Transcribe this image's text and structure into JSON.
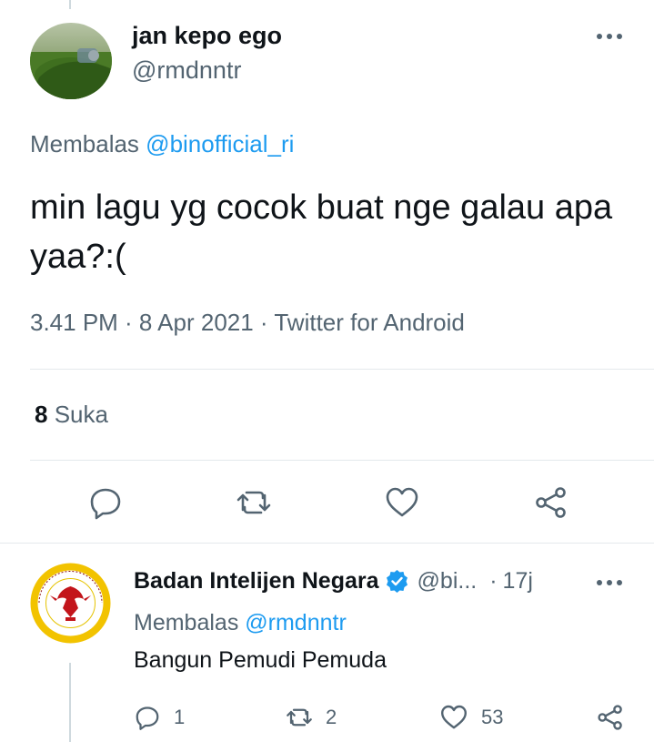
{
  "tweet": {
    "author_name": "jan kepo ego",
    "author_handle": "@rmdnntr",
    "reply_prefix": "Membalas",
    "reply_to": "@binofficial_ri",
    "text": "min lagu yg cocok buat nge galau apa yaa?:(",
    "meta": "3.41 PM · 8 Apr 2021 · Twitter for Android",
    "likes_count": "8",
    "likes_label": "Suka"
  },
  "reply": {
    "author_name": "Badan Intelijen Negara",
    "author_handle": "@bi...",
    "time_sep": "·",
    "time": "17j",
    "reply_prefix": "Membalas",
    "reply_to": "@rmdnntr",
    "text": "Bangun Pemudi Pemuda",
    "reply_count": "1",
    "retweet_count": "2",
    "like_count": "53"
  },
  "icons": {
    "main_actions": [
      "reply-icon",
      "retweet-icon",
      "like-icon",
      "share-icon"
    ],
    "reply_actions": [
      "reply-icon",
      "retweet-icon",
      "like-icon",
      "share-icon"
    ],
    "more": "more-icon",
    "verified": "verified-badge-icon"
  },
  "colors": {
    "accent": "#1d9bf0",
    "secondary_text": "#536471",
    "primary_text": "#0f1419",
    "divider": "#e4e9ec"
  }
}
